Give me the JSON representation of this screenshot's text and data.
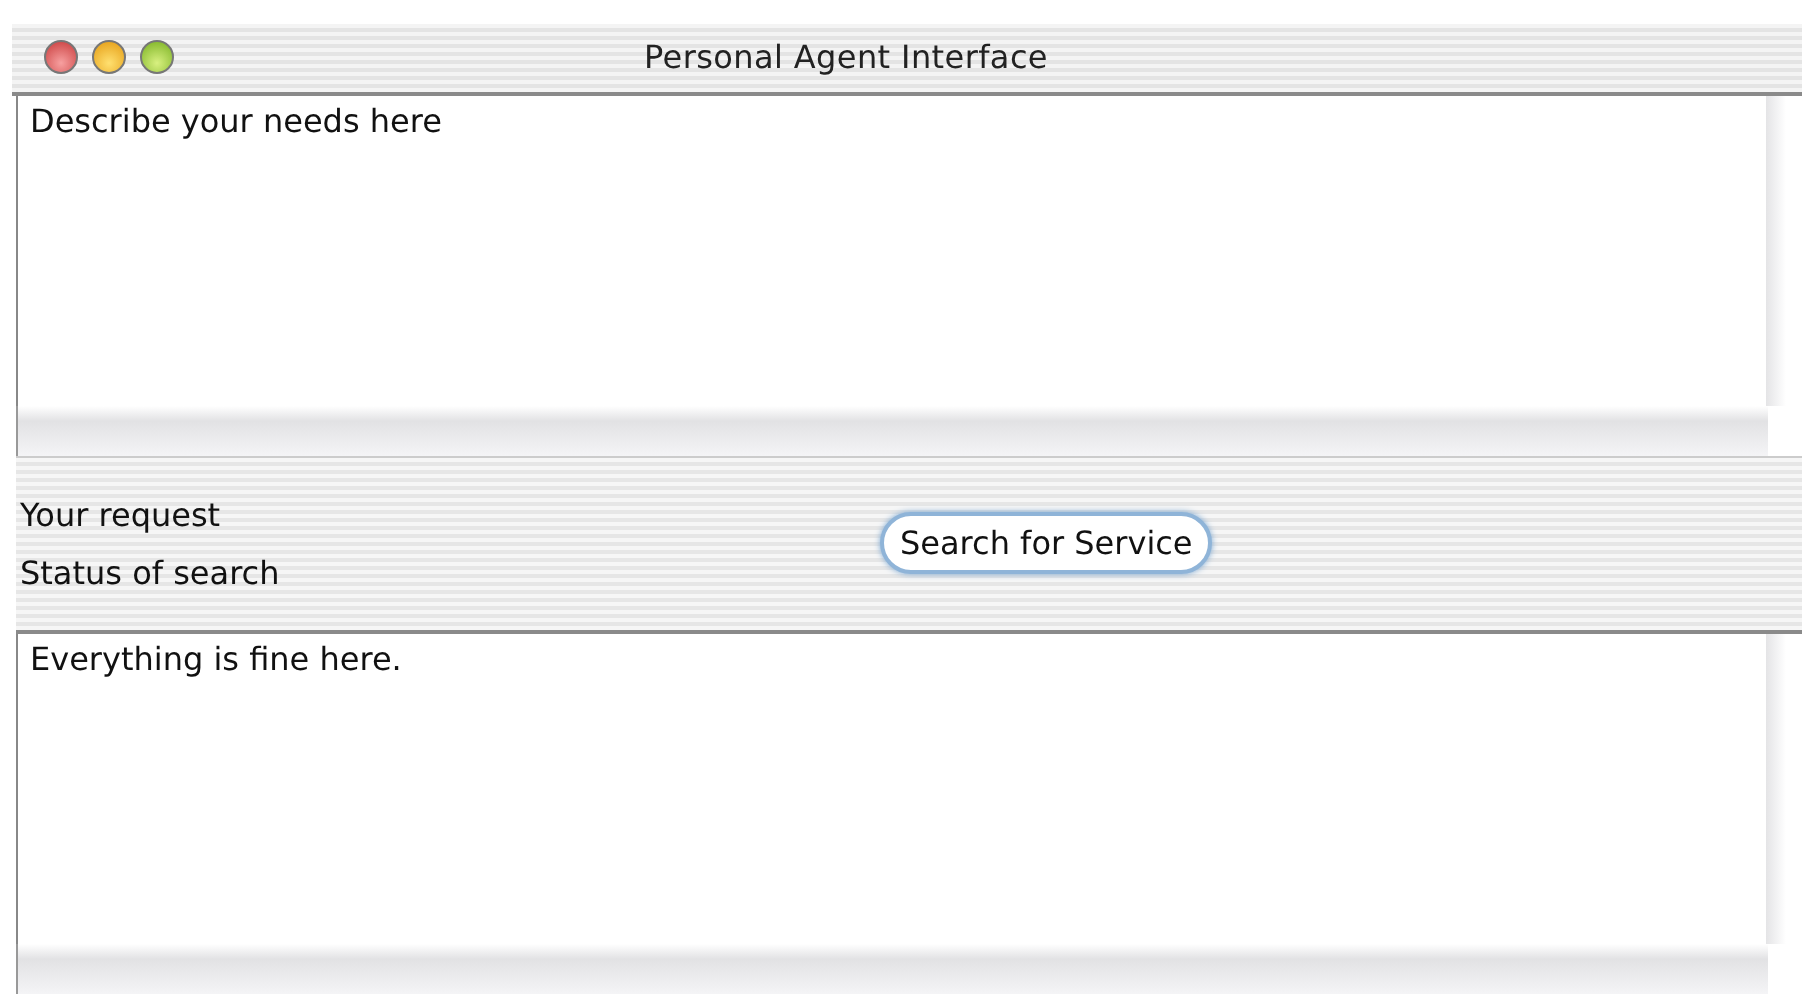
{
  "window": {
    "title": "Personal Agent Interface"
  },
  "request_area": {
    "value": "Describe your needs here"
  },
  "labels": [
    "Your request",
    "Status of search"
  ],
  "search_button": {
    "label": "Search for Service"
  },
  "status_area": {
    "value": "Everything is fine here."
  }
}
